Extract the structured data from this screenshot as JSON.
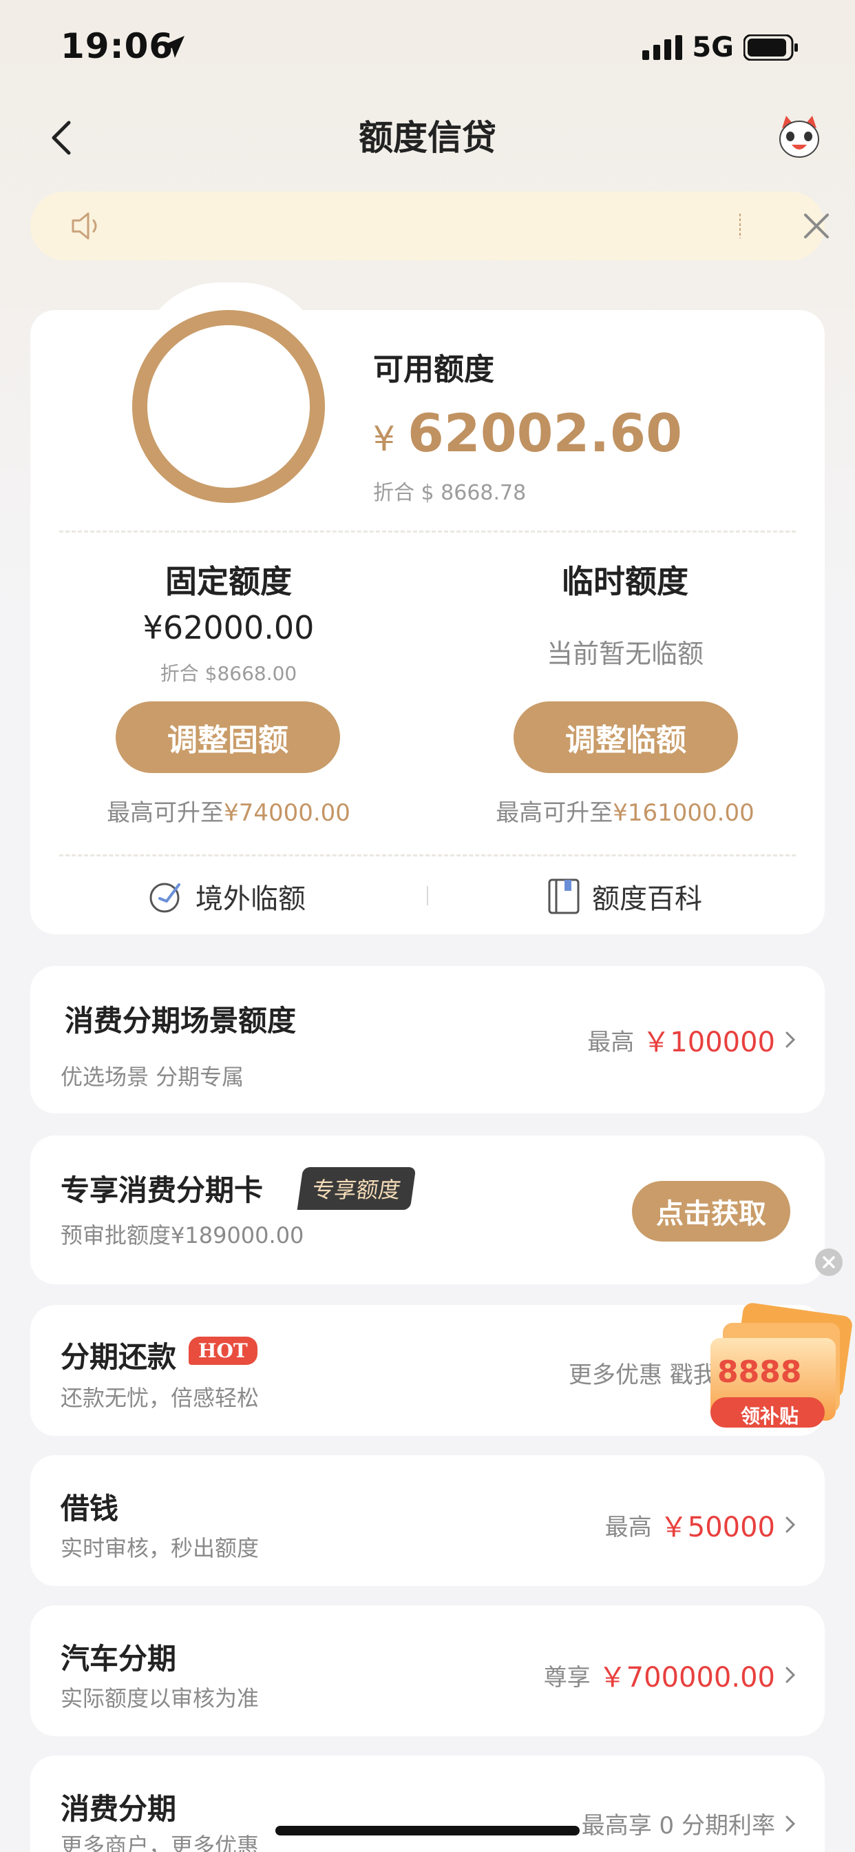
{
  "status_bar": {
    "time": "19:06",
    "network": "5G"
  },
  "nav": {
    "title": "额度信贷"
  },
  "summary": {
    "available_label": "可用额度",
    "currency": "¥",
    "available_amount": "62002.60",
    "available_usd": "折合 $ 8668.78"
  },
  "fixed": {
    "title": "固定额度",
    "amount": "¥62000.00",
    "usd": "折合 $8668.00",
    "button": "调整固额",
    "max_prefix": "最高可升至",
    "max_value": "¥74000.00"
  },
  "temp": {
    "title": "临时额度",
    "none": "当前暂无临额",
    "button": "调整临额",
    "max_prefix": "最高可升至",
    "max_value": "¥161000.00"
  },
  "links": {
    "overseas": "境外临额",
    "wiki": "额度百科"
  },
  "items": {
    "scene": {
      "title": "消费分期场景额度",
      "sub": "优选场景 分期专属",
      "prefix": "最高",
      "value": "￥100000"
    },
    "card": {
      "title": "专享消费分期卡",
      "tag": "专享额度",
      "sub": "预审批额度¥189000.00",
      "button": "点击获取"
    },
    "repay": {
      "title": "分期还款",
      "hot": "HOT",
      "sub": "还款无忧，倍感轻松",
      "right": "更多优惠 戳我"
    },
    "loan": {
      "title": "借钱",
      "sub": "实时审核，秒出额度",
      "prefix": "最高",
      "value": "￥50000"
    },
    "car": {
      "title": "汽车分期",
      "sub": "实际额度以审核为准",
      "prefix": "尊享",
      "value": "￥700000.00"
    },
    "consume": {
      "title": "消费分期",
      "sub": "更多商户，更多优惠",
      "right": "最高享 0 分期利率"
    }
  },
  "coupon": {
    "amount": "8888",
    "label": "领补贴"
  },
  "colors": {
    "gold": "#c99c69",
    "red": "#e8403e",
    "notice_bg": "#fbf3de"
  }
}
